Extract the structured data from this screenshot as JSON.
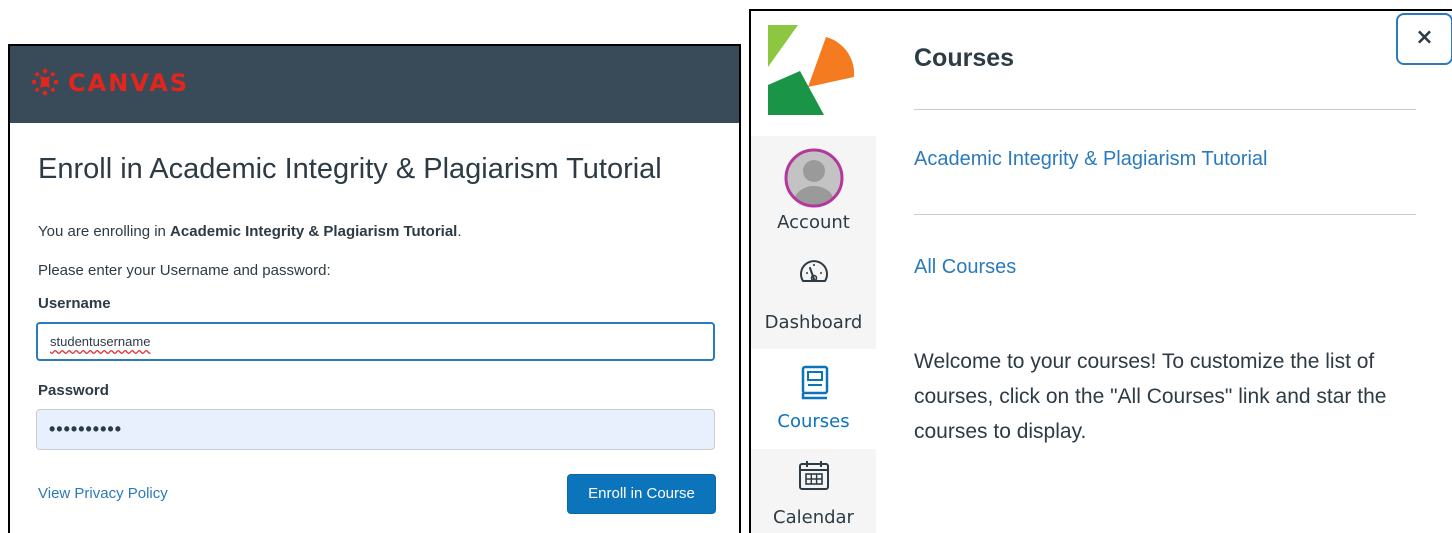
{
  "enroll_page": {
    "brand": "CANVAS",
    "title": "Enroll in Academic Integrity & Plagiarism Tutorial",
    "enrolling_prefix": "You are enrolling in ",
    "course_name": "Academic Integrity & Plagiarism Tutorial",
    "enrolling_suffix": ".",
    "instructions": "Please enter your Username and password:",
    "username_label": "Username",
    "username_value": "studentusername",
    "password_label": "Password",
    "password_value": "••••••••••",
    "privacy_link": "View Privacy Policy",
    "enroll_button": "Enroll in Course",
    "brand_color": "#e4251c",
    "header_color": "#394b58",
    "accent_color": "#0b74bb"
  },
  "global_nav": {
    "logo_icon": "k-logo-icon",
    "items": [
      {
        "label": "Account",
        "icon": "user-avatar-icon"
      },
      {
        "label": "Dashboard",
        "icon": "dashboard-gauge-icon"
      },
      {
        "label": "Courses",
        "icon": "book-icon",
        "active": true
      },
      {
        "label": "Calendar",
        "icon": "calendar-icon"
      }
    ]
  },
  "courses_tray": {
    "title": "Courses",
    "close_icon": "×",
    "course_link": "Academic Integrity & Plagiarism Tutorial",
    "all_courses_link": "All Courses",
    "welcome_text": "Welcome to your courses! To customize the list of courses, click on the \"All Courses\" link and star the courses to display.",
    "link_color": "#2b7abc"
  }
}
